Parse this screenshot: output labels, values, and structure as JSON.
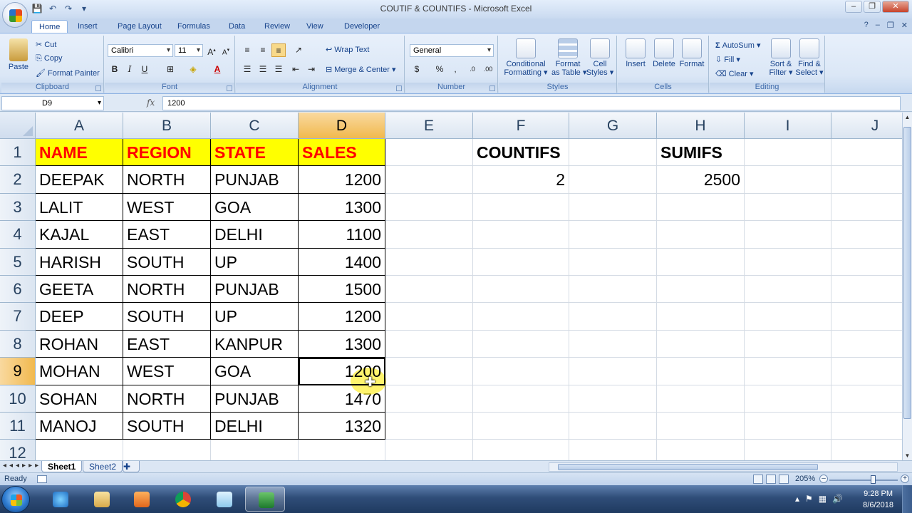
{
  "window": {
    "title": "COUTIF & COUNTIFS - Microsoft Excel",
    "controls": {
      "minimize": "–",
      "restore": "❐",
      "close": "✕"
    }
  },
  "ribbon_tabs": [
    "Home",
    "Insert",
    "Page Layout",
    "Formulas",
    "Data",
    "Review",
    "View",
    "Developer"
  ],
  "ribbon": {
    "clipboard": {
      "label": "Clipboard",
      "paste": "Paste",
      "cut": "Cut",
      "copy": "Copy",
      "format_painter": "Format Painter"
    },
    "font": {
      "label": "Font",
      "font_name": "Calibri",
      "font_size": "11"
    },
    "alignment": {
      "label": "Alignment",
      "wrap_text": "Wrap Text",
      "merge_center": "Merge & Center"
    },
    "number": {
      "label": "Number",
      "format": "General"
    },
    "styles": {
      "label": "Styles",
      "conditional_1": "Conditional",
      "conditional_2": "Formatting",
      "format_table_1": "Format",
      "format_table_2": "as Table",
      "cell_styles_1": "Cell",
      "cell_styles_2": "Styles"
    },
    "cells": {
      "label": "Cells",
      "insert": "Insert",
      "delete": "Delete",
      "format": "Format"
    },
    "editing": {
      "label": "Editing",
      "autosum": "AutoSum",
      "fill": "Fill",
      "clear": "Clear",
      "sort_1": "Sort &",
      "sort_2": "Filter",
      "find_1": "Find &",
      "find_2": "Select"
    }
  },
  "formula_bar": {
    "name_box": "D9",
    "fx": "fx",
    "content": "1200"
  },
  "columns": [
    "A",
    "B",
    "C",
    "D",
    "E",
    "F",
    "G",
    "H",
    "I",
    "J"
  ],
  "rows": [
    "1",
    "2",
    "3",
    "4",
    "5",
    "6",
    "7",
    "8",
    "9",
    "10",
    "11",
    "12"
  ],
  "sheet": {
    "headers": [
      "NAME",
      "REGION",
      "STATE",
      "SALES"
    ],
    "data": [
      [
        "DEEPAK",
        "NORTH",
        "PUNJAB",
        "1200"
      ],
      [
        "LALIT",
        "WEST",
        "GOA",
        "1300"
      ],
      [
        "KAJAL",
        "EAST",
        "DELHI",
        "1100"
      ],
      [
        "HARISH",
        "SOUTH",
        "UP",
        "1400"
      ],
      [
        "GEETA",
        "NORTH",
        "PUNJAB",
        "1500"
      ],
      [
        "DEEP",
        "SOUTH",
        "UP",
        "1200"
      ],
      [
        "ROHAN",
        "EAST",
        "KANPUR",
        "1300"
      ],
      [
        "MOHAN",
        "WEST",
        "GOA",
        "1200"
      ],
      [
        "SOHAN",
        "NORTH",
        "PUNJAB",
        "1470"
      ],
      [
        "MANOJ",
        "SOUTH",
        "DELHI",
        "1320"
      ]
    ],
    "countifs_label": "COUNTIFS",
    "countifs_value": "2",
    "sumifs_label": "SUMIFS",
    "sumifs_value": "2500",
    "active_cell": "D9"
  },
  "sheet_tabs": [
    "Sheet1",
    "Sheet2"
  ],
  "status": {
    "ready": "Ready",
    "zoom": "205%"
  },
  "taskbar": {
    "time": "9:28 PM",
    "date": "8/6/2018"
  },
  "colors": {
    "header_fill": "#ffff00",
    "header_text": "#ff0000",
    "selected_header": "#f1b94e"
  }
}
